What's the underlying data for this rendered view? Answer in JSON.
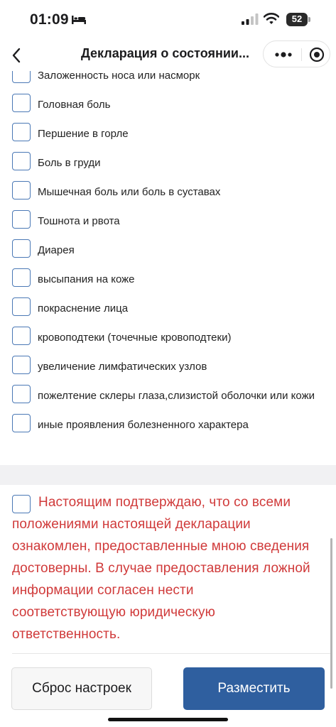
{
  "status_bar": {
    "time": "01:09",
    "battery": "52",
    "battery_level": 0.52,
    "icons": [
      "bed-icon",
      "signal-icon",
      "wifi-icon",
      "battery-icon"
    ]
  },
  "header": {
    "title": "Декларация о состоянии...",
    "icons": [
      "chevron-left-icon",
      "more-dots-icon",
      "close-circle-icon"
    ]
  },
  "symptoms": [
    {
      "label": "Заложенность носа или насморк",
      "checked": false
    },
    {
      "label": "Головная боль",
      "checked": false
    },
    {
      "label": "Першение в горле",
      "checked": false
    },
    {
      "label": "Боль в груди",
      "checked": false
    },
    {
      "label": "Мышечная боль или боль в суставах",
      "checked": false
    },
    {
      "label": "Тошнота и рвота",
      "checked": false
    },
    {
      "label": "Диарея",
      "checked": false
    },
    {
      "label": "высыпания на коже",
      "checked": false
    },
    {
      "label": "покраснение лица",
      "checked": false
    },
    {
      "label": "кровоподтеки (точечные кровоподтеки)",
      "checked": false
    },
    {
      "label": "увеличение лимфатических узлов",
      "checked": false
    },
    {
      "label": "пожелтение склеры глаза,слизистой оболочки или кожи",
      "checked": false
    },
    {
      "label": "иные проявления болезненного характера",
      "checked": false
    }
  ],
  "confirmation": {
    "text": "Настоящим подтверждаю, что со всеми положениями настоящей декларации ознакомлен, предоставленные мною сведения достоверны. В случае предоставления ложной информации согласен нести соответствующую юридическую ответственность.",
    "checked": false,
    "color": "#d03a3a"
  },
  "actions": {
    "reset_label": "Сброс настроек",
    "submit_label": "Разместить"
  },
  "colors": {
    "accent": "#2f5f9f",
    "checkbox_border": "#4a78b5",
    "warning_text": "#d03a3a"
  }
}
